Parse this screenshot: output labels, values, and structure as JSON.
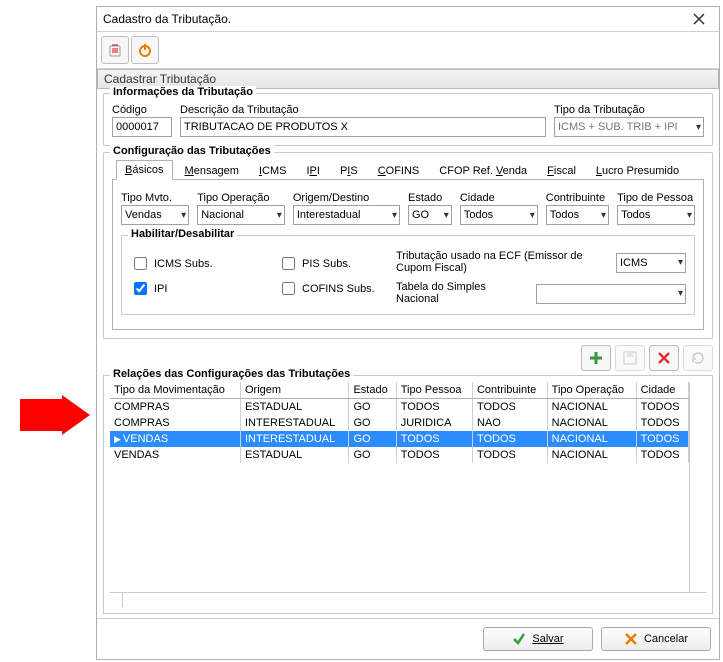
{
  "window": {
    "title": "Cadastro da Tributação."
  },
  "sectionTitle": "Cadastrar Tributação",
  "info": {
    "groupTitle": "Informações da Tributação",
    "codigoLabel": "Código",
    "descricaoLabel": "Descrição da Tributação",
    "tipoLabel": "Tipo da Tributação",
    "codigo": "0000017",
    "descricao": "TRIBUTACAO DE PRODUTOS X",
    "tipo": "ICMS + SUB. TRIB + IPI"
  },
  "config": {
    "groupTitle": "Configuração das Tributações",
    "tabs": [
      {
        "label": "Básicos",
        "accel": "B",
        "active": true
      },
      {
        "label": "Mensagem",
        "accel": "M"
      },
      {
        "label": "ICMS",
        "accel": "I"
      },
      {
        "label": "IPI",
        "accel": "P"
      },
      {
        "label": "PIS",
        "accel": "I"
      },
      {
        "label": "COFINS",
        "accel": "C"
      },
      {
        "label": "CFOP Ref. Venda",
        "accel": "V"
      },
      {
        "label": "Fiscal",
        "accel": "F"
      },
      {
        "label": "Lucro Presumido",
        "accel": "L"
      }
    ],
    "fields": {
      "tipoMvtoLabel": "Tipo Mvto.",
      "tipoOperacaoLabel": "Tipo Operação",
      "origemDestinoLabel": "Origem/Destino",
      "estadoLabel": "Estado",
      "cidadeLabel": "Cidade",
      "contribuinteLabel": "Contribuinte",
      "tipoPessoaLabel": "Tipo de Pessoa",
      "tipoMvto": "Vendas",
      "tipoOperacao": "Nacional",
      "origemDestino": "Interestadual",
      "estado": "GO",
      "cidade": "Todos",
      "contribuinte": "Todos",
      "tipoPessoa": "Todos"
    },
    "habilitar": {
      "groupTitle": "Habilitar/Desabilitar",
      "icmsSubs": "ICMS Subs.",
      "ipi": "IPI",
      "pisSubs": "PIS Subs.",
      "cofinsSubs": "COFINS Subs.",
      "ipiChecked": true,
      "ecfLabel": "Tributação usado na ECF (Emissor de Cupom Fiscal)",
      "ecfValue": "ICMS",
      "simplesLabel": "Tabela do Simples Nacional",
      "simplesValue": ""
    }
  },
  "relacoes": {
    "title": "Relações das Configurações das Tributações",
    "columns": [
      "Tipo da Movimentação",
      "Origem",
      "Estado",
      "Tipo Pessoa",
      "Contribuinte",
      "Tipo Operação",
      "Cidade"
    ],
    "rows": [
      {
        "c": [
          "COMPRAS",
          "ESTADUAL",
          "GO",
          "TODOS",
          "TODOS",
          "NACIONAL",
          "TODOS"
        ],
        "sel": false
      },
      {
        "c": [
          "COMPRAS",
          "INTERESTADUAL",
          "GO",
          "JURIDICA",
          "NAO",
          "NACIONAL",
          "TODOS"
        ],
        "sel": false
      },
      {
        "c": [
          "VENDAS",
          "INTERESTADUAL",
          "GO",
          "TODOS",
          "TODOS",
          "NACIONAL",
          "TODOS"
        ],
        "sel": true
      },
      {
        "c": [
          "VENDAS",
          "ESTADUAL",
          "GO",
          "TODOS",
          "TODOS",
          "NACIONAL",
          "TODOS"
        ],
        "sel": false
      }
    ]
  },
  "footer": {
    "salvar": "Salvar",
    "cancelar": "Cancelar"
  }
}
